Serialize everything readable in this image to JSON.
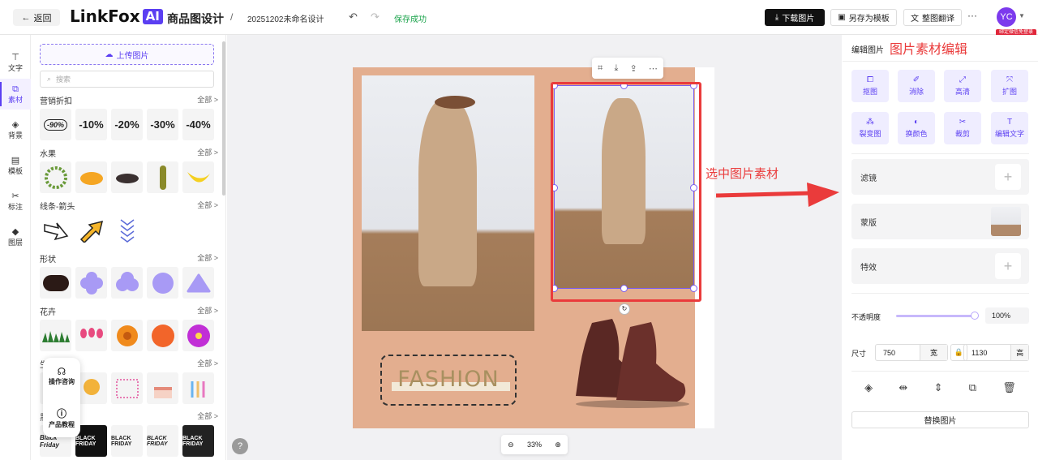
{
  "header": {
    "back_label": "返回",
    "logo_text": "LinkFox",
    "logo_ai": "AI",
    "app_title": "商品图设计",
    "separator": "/",
    "doc_name": "20251202未命名设计",
    "save_status": "保存成功",
    "download_label": "下载图片",
    "save_template_label": "另存为模板",
    "translate_label": "整图翻译",
    "more_label": "···",
    "avatar_text": "YC",
    "bind_tag": "绑定微信免登录"
  },
  "rail": {
    "items": [
      {
        "label": "文字",
        "icon": "text-icon"
      },
      {
        "label": "素材",
        "icon": "asset-icon",
        "active": true
      },
      {
        "label": "背景",
        "icon": "background-icon"
      },
      {
        "label": "模板",
        "icon": "template-icon"
      },
      {
        "label": "标注",
        "icon": "annotation-icon"
      },
      {
        "label": "图层",
        "icon": "layers-icon"
      }
    ]
  },
  "assets": {
    "upload_label": "上传图片",
    "search_placeholder": "搜索",
    "all_label": "全部 >",
    "categories": [
      {
        "name": "营销折扣",
        "items": [
          "-90%",
          "-10%",
          "-20%",
          "-30%",
          "-40%"
        ]
      },
      {
        "name": "水果"
      },
      {
        "name": "线条-箭头"
      },
      {
        "name": "形状"
      },
      {
        "name": "花卉"
      },
      {
        "name": "生日"
      },
      {
        "name": "黑五",
        "items": [
          "Black Friday",
          "BLACK FRIDAY",
          "BLACK FRIDAY",
          "BLACK FRIDAY",
          "BLACK FRIDAY"
        ]
      }
    ],
    "help": {
      "consult": "操作咨询",
      "tutorial": "产品教程"
    }
  },
  "canvas": {
    "fashion_text": "FASHION",
    "annotation_text": "选中图片素材",
    "zoom": "33%"
  },
  "right_panel": {
    "tab_label": "编辑图片",
    "annotation": "图片素材编辑",
    "tools": [
      "抠图",
      "消除",
      "高清",
      "扩图",
      "裂变图",
      "换颜色",
      "裁剪",
      "编辑文字"
    ],
    "filter_label": "滤镜",
    "mask_label": "蒙版",
    "effect_label": "特效",
    "opacity_label": "不透明度",
    "opacity_value": "100%",
    "opacity": 1.0,
    "size_label": "尺寸",
    "width": "750",
    "width_unit": "宽",
    "height": "1130",
    "height_unit": "高",
    "replace_label": "替换图片"
  },
  "colors": {
    "accent": "#5b3ff2",
    "annotation_red": "#ea3b3b",
    "board_bg": "#e3ae8f",
    "success": "#19a34a"
  }
}
